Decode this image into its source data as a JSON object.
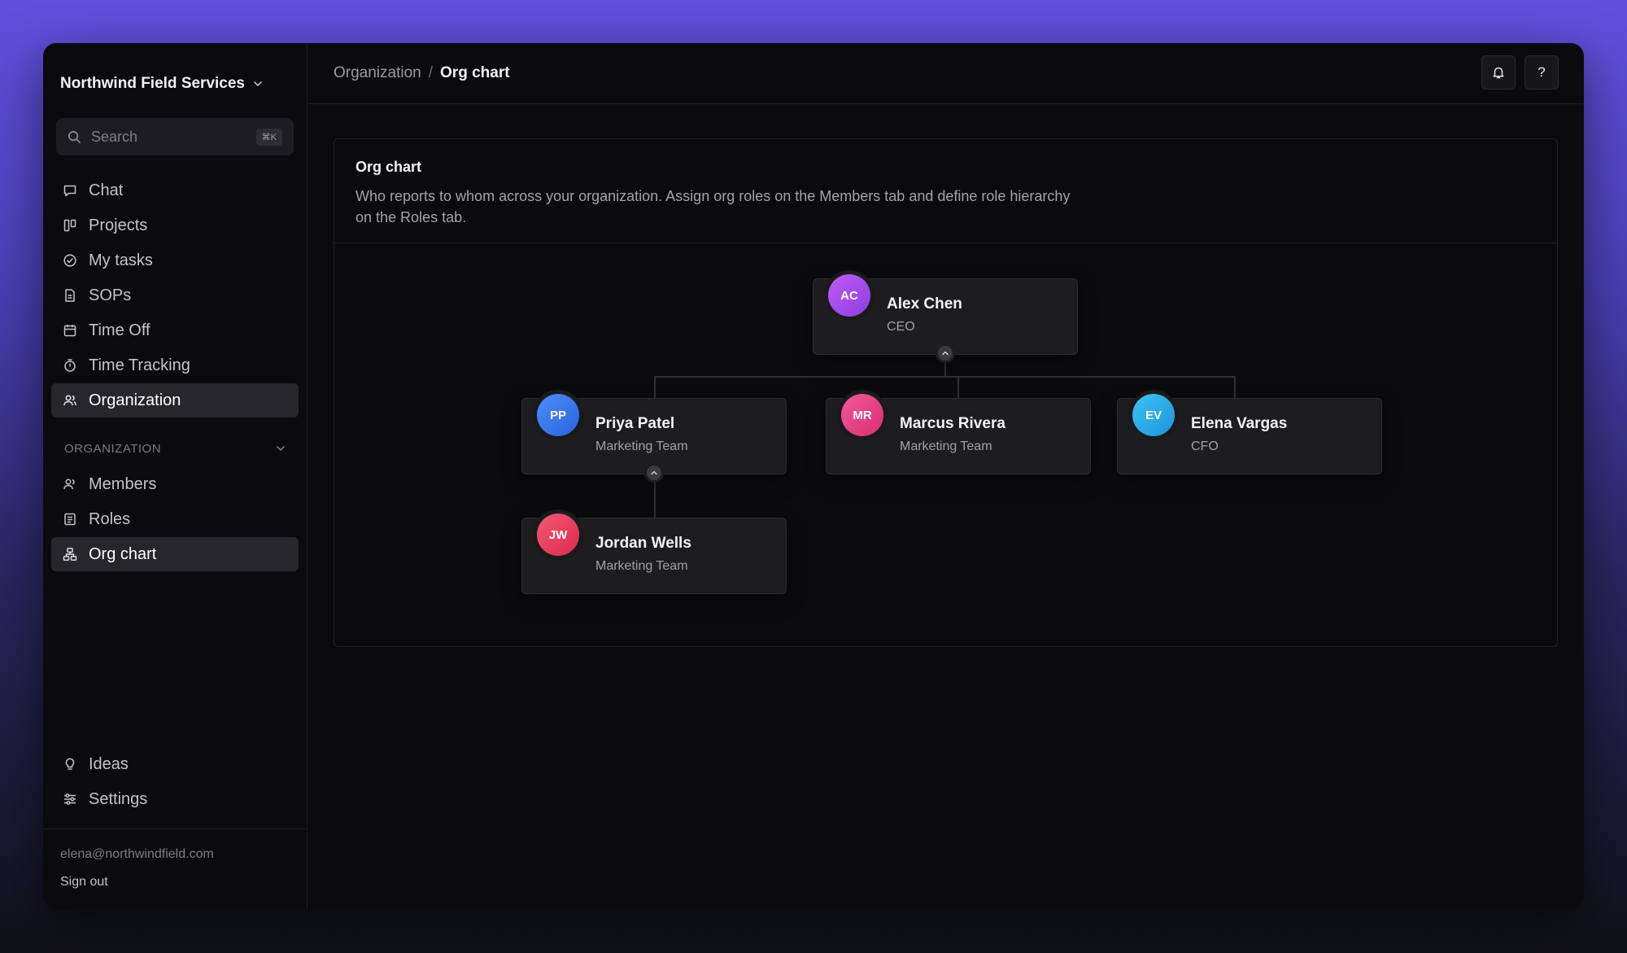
{
  "workspace": {
    "name": "Northwind Field Services"
  },
  "search": {
    "placeholder": "Search",
    "shortcut": "⌘K"
  },
  "nav": {
    "items": [
      {
        "label": "Chat",
        "icon": "chat-icon"
      },
      {
        "label": "Projects",
        "icon": "kanban-icon"
      },
      {
        "label": "My tasks",
        "icon": "check-circle-icon"
      },
      {
        "label": "SOPs",
        "icon": "document-icon"
      },
      {
        "label": "Time Off",
        "icon": "calendar-icon"
      },
      {
        "label": "Time Tracking",
        "icon": "stopwatch-icon"
      },
      {
        "label": "Organization",
        "icon": "users-icon",
        "active": true
      }
    ]
  },
  "org_section": {
    "label": "ORGANIZATION",
    "items": [
      {
        "label": "Members",
        "icon": "members-icon"
      },
      {
        "label": "Roles",
        "icon": "list-icon"
      },
      {
        "label": "Org chart",
        "icon": "hierarchy-icon",
        "active": true
      }
    ]
  },
  "bottom_nav": {
    "items": [
      {
        "label": "Ideas",
        "icon": "lightbulb-icon"
      },
      {
        "label": "Settings",
        "icon": "sliders-icon"
      }
    ]
  },
  "account": {
    "email": "elena@northwindfield.com",
    "signout": "Sign out"
  },
  "breadcrumb": {
    "parent": "Organization",
    "separator": "/",
    "current": "Org chart"
  },
  "topbar": {
    "help_label": "?"
  },
  "card": {
    "title": "Org chart",
    "description": "Who reports to whom across your organization. Assign org roles on the Members tab and define role hierarchy on the Roles tab."
  },
  "org_chart": {
    "nodes": [
      {
        "initials": "AC",
        "name": "Alex Chen",
        "role": "CEO",
        "color_from": "#c05cf5",
        "color_to": "#8b3ee0"
      },
      {
        "initials": "PP",
        "name": "Priya Patel",
        "role": "Marketing Team",
        "color_from": "#4d8ef7",
        "color_to": "#2a63e0"
      },
      {
        "initials": "MR",
        "name": "Marcus Rivera",
        "role": "Marketing Team",
        "color_from": "#f05a9a",
        "color_to": "#d92d74"
      },
      {
        "initials": "EV",
        "name": "Elena Vargas",
        "role": "CFO",
        "color_from": "#3ec3f2",
        "color_to": "#1a94dc"
      },
      {
        "initials": "JW",
        "name": "Jordan Wells",
        "role": "Marketing Team",
        "color_from": "#f25a73",
        "color_to": "#dc2a4c"
      }
    ]
  }
}
